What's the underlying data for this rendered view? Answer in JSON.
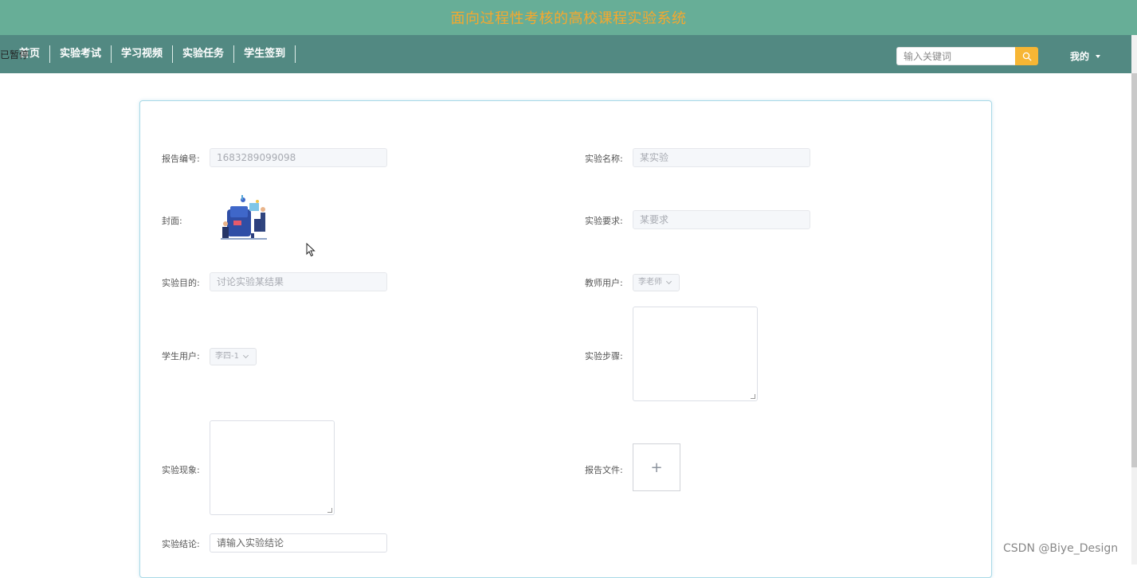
{
  "header": {
    "title": "面向过程性考核的高校课程实验系统"
  },
  "nav": {
    "items": [
      "首页",
      "实验考试",
      "学习视频",
      "实验任务",
      "学生签到"
    ],
    "paused_overlay": "已暂停",
    "search_placeholder": "输入关键词",
    "mine_label": "我的"
  },
  "form": {
    "report_no": {
      "label": "报告编号:",
      "value": "1683289099098"
    },
    "exp_name": {
      "label": "实验名称:",
      "value": "某实验"
    },
    "cover": {
      "label": "封面:"
    },
    "exp_req": {
      "label": "实验要求:",
      "value": "某要求"
    },
    "exp_purpose": {
      "label": "实验目的:",
      "value": "讨论实验某结果"
    },
    "teacher": {
      "label": "教师用户:",
      "value": "李老师"
    },
    "student": {
      "label": "学生用户:",
      "value": "李四-1"
    },
    "exp_steps": {
      "label": "实验步骤:"
    },
    "exp_phenomenon": {
      "label": "实验现象:"
    },
    "report_file": {
      "label": "报告文件:",
      "upload_symbol": "+"
    },
    "exp_conclusion": {
      "label": "实验结论:",
      "placeholder": "请输入实验结论"
    }
  },
  "watermark": "CSDN @Biye_Design",
  "colors": {
    "titlebar": "#67ae97",
    "title_text": "#f6a82d",
    "navbar": "#528982",
    "search_button": "#f7b634",
    "card_border": "#a9d9e7"
  },
  "icons": {
    "search": "search-icon",
    "caret": "caret-down-icon",
    "select_chevron": "chevron-down-icon",
    "cursor": "mouse-cursor-icon"
  }
}
